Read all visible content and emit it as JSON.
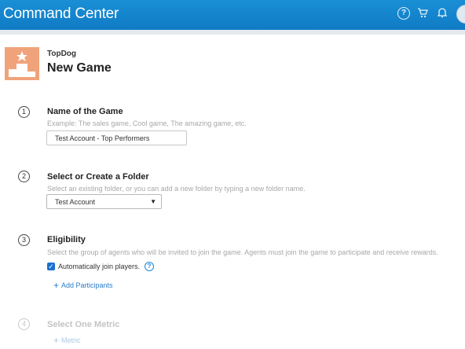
{
  "header": {
    "title": "Command Center",
    "icons": [
      "help-icon",
      "cart-icon",
      "bell-icon",
      "avatar"
    ]
  },
  "brand": {
    "name": "TopDog",
    "logo_color": "#f0a37a"
  },
  "page": {
    "title": "New Game"
  },
  "steps": [
    {
      "number": "1",
      "title": "Name of the Game",
      "hint": "Example: The sales game, Cool game, The amazing game, etc.",
      "input_value": "Test Account - Top Performers"
    },
    {
      "number": "2",
      "title": "Select or Create a Folder",
      "hint": "Select an existing folder, or you can add a new folder by typing a new folder name.",
      "select_value": "Test Account"
    },
    {
      "number": "3",
      "title": "Eligibility",
      "hint": "Select the group of agents who will be invited to join the game. Agents must join the game to participate and receive rewards.",
      "checkbox_label": "Automatically join players.",
      "checkbox_checked": true,
      "add_link": "Add Participants"
    },
    {
      "number": "4",
      "title": "Select One Metric",
      "add_link": "Metric"
    }
  ],
  "colors": {
    "header_blue": "#1a8fd6",
    "link_blue": "#2a7cc7",
    "checkbox_blue": "#1a6fd0"
  }
}
